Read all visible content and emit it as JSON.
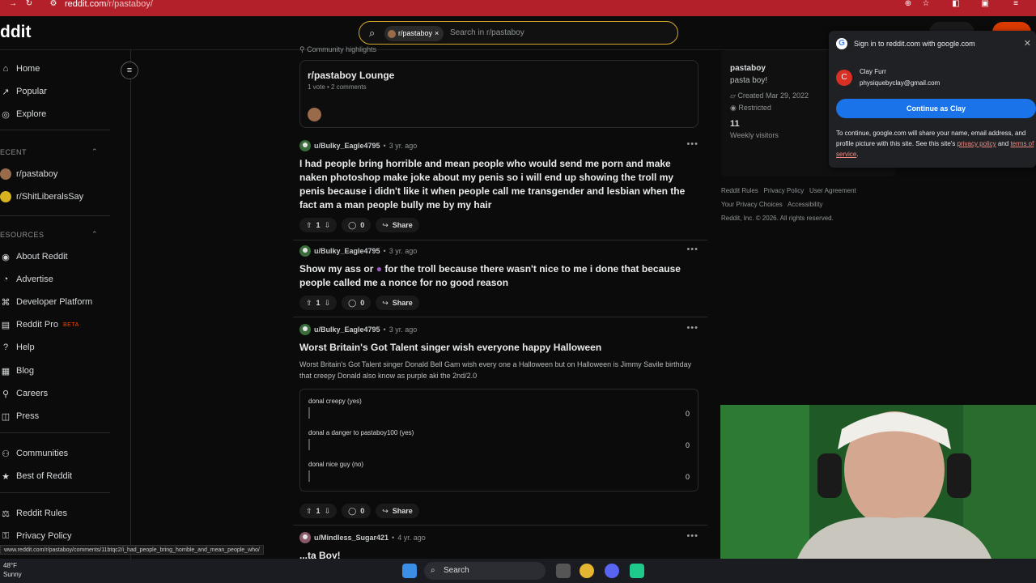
{
  "browser": {
    "url_prefix": "reddit.com",
    "url_path": "/r/pastaboy/"
  },
  "header": {
    "logo": "ddit",
    "search_chip": "r/pastaboy",
    "search_placeholder": "Search in r/pastaboy"
  },
  "sidebar": {
    "nav": [
      {
        "label": "Home",
        "icon": "home-icon"
      },
      {
        "label": "Popular",
        "icon": "popular-icon"
      },
      {
        "label": "Explore",
        "icon": "explore-icon"
      }
    ],
    "recent_header": "ECENT",
    "recent": [
      {
        "label": "r/pastaboy"
      },
      {
        "label": "r/ShitLiberalsSay"
      }
    ],
    "resources_header": "ESOURCES",
    "resources": [
      {
        "label": "About Reddit",
        "icon": "about-icon"
      },
      {
        "label": "Advertise",
        "icon": "advertise-icon"
      },
      {
        "label": "Developer Platform",
        "icon": "developer-icon"
      },
      {
        "label": "Reddit Pro",
        "icon": "pro-icon",
        "badge": "BETA"
      },
      {
        "label": "Help",
        "icon": "help-icon"
      },
      {
        "label": "Blog",
        "icon": "blog-icon"
      },
      {
        "label": "Careers",
        "icon": "careers-icon"
      },
      {
        "label": "Press",
        "icon": "press-icon"
      }
    ],
    "more": [
      {
        "label": "Communities",
        "icon": "communities-icon"
      },
      {
        "label": "Best of Reddit",
        "icon": "best-icon"
      }
    ],
    "legal": [
      {
        "label": "Reddit Rules",
        "icon": "rules-icon"
      },
      {
        "label": "Privacy Policy",
        "icon": "privacy-icon"
      }
    ]
  },
  "highlights": {
    "header": "Community highlights",
    "title": "r/pastaboy Lounge",
    "meta": "1 vote • 2 comments"
  },
  "posts": [
    {
      "user": "u/Bulky_Eagle4795",
      "age": "3 yr. ago",
      "title": "I had people bring horrible and mean people who would send me porn and make naken photoshop make joke about my penis so i will end up showing the troll my penis because i didn't like it when people call me transgender and lesbian when the fact am a man people bully me by my hair",
      "votes": "1",
      "comments": "0",
      "share": "Share"
    },
    {
      "user": "u/Bulky_Eagle4795",
      "age": "3 yr. ago",
      "title_a": "Show my ass or",
      "title_b": "for the troll because there wasn't nice to me i done that because people called me a nonce for no good reason",
      "votes": "1",
      "comments": "0",
      "share": "Share"
    },
    {
      "user": "u/Bulky_Eagle4795",
      "age": "3 yr. ago",
      "title": "Worst Britain's Got Talent singer wish everyone happy Halloween",
      "body": "Worst Britain's Got Talent singer Donald Bell Gam wish every one a Halloween but on Halloween is Jimmy Savile birthday that creepy Donald also know as purple aki the 2nd/2.0",
      "poll": [
        {
          "label": "donal creepy (yes)",
          "count": "0"
        },
        {
          "label": "donal a danger to pastaboy100 (yes)",
          "count": "0"
        },
        {
          "label": "donal nice guy (no)",
          "count": "0"
        }
      ],
      "votes": "1",
      "comments": "0",
      "share": "Share"
    },
    {
      "user": "u/Mindless_Sugar421",
      "age": "4 yr. ago",
      "title": "...ta Boy!"
    }
  ],
  "community": {
    "name": "pastaboy",
    "desc": "pasta boy!",
    "created": "Created Mar 29, 2022",
    "status": "Restricted",
    "visitors": "11",
    "visitors_label": "Weekly visitors"
  },
  "footer": {
    "row1": [
      "Reddit Rules",
      "Privacy Policy",
      "User Agreement"
    ],
    "row2": [
      "Your Privacy Choices",
      "Accessibility"
    ],
    "copyright": "Reddit, Inc. © 2026. All rights reserved."
  },
  "google_popup": {
    "title": "Sign in to reddit.com with google.com",
    "initial": "C",
    "name": "Clay Furr",
    "email": "physiquebyclay@gmail.com",
    "button": "Continue as Clay",
    "disclaimer": "To continue, google.com will share your name, email address, and profile picture with this site. See this site's",
    "privacy": "privacy policy",
    "and": "and",
    "terms": "terms of service",
    "end": "."
  },
  "status_url": "www.reddit.com/r/pastaboy/comments/11btqc2/i_had_people_bring_horrible_and_mean_people_who/",
  "taskbar": {
    "temp": "48°F",
    "weather": "Sunny",
    "search": "Search"
  },
  "colors": {
    "accent": "#d4a52b",
    "google_blue": "#1a73e8",
    "beta": "#ff4500",
    "browser_red": "#b3202a"
  }
}
